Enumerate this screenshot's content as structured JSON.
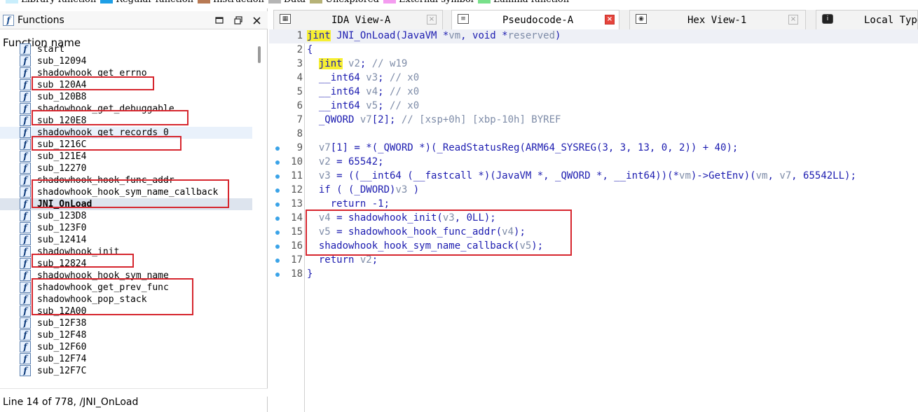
{
  "legend": [
    {
      "label": "Library function",
      "color": "#c9eefc"
    },
    {
      "label": "Regular function",
      "color": "#1e9fe6"
    },
    {
      "label": "Instruction",
      "color": "#b87a54"
    },
    {
      "label": "Data",
      "color": "#b5b5b5"
    },
    {
      "label": "Unexplored",
      "color": "#b6b277"
    },
    {
      "label": "External symbol",
      "color": "#f49cf0"
    },
    {
      "label": "Lumina function",
      "color": "#78e08a"
    }
  ],
  "functions_panel": {
    "title": "Functions",
    "icon_glyph": "f",
    "column_header": "Function name",
    "items": [
      "start",
      "sub_12094",
      "shadowhook_get_errno",
      "sub_120A4",
      "sub_120B8",
      "shadowhook_get_debuggable",
      "sub_120E8",
      "shadowhook_get_records_0",
      "sub_1216C",
      "sub_121E4",
      "sub_12270",
      "shadowhook_hook_func_addr",
      "shadowhook_hook_sym_name_callback",
      "JNI_OnLoad",
      "sub_123D8",
      "sub_123F0",
      "sub_12414",
      "shadowhook_init",
      "sub_12824",
      "shadowhook_hook_sym_name",
      "shadowhook_get_prev_func",
      "shadowhook_pop_stack",
      "sub_12A00",
      "sub_12F38",
      "sub_12F48",
      "sub_12F60",
      "sub_12F74",
      "sub_12F7C"
    ],
    "status": "Line 14 of 778, /JNI_OnLoad"
  },
  "tabs": [
    {
      "label": "IDA View-A",
      "icon": "graph-view-icon",
      "close": "×"
    },
    {
      "label": "Pseudocode-A",
      "icon": "pseudocode-icon",
      "close": "×"
    },
    {
      "label": "Hex View-1",
      "icon": "hex-view-icon",
      "close": "×"
    },
    {
      "label": "Local Types",
      "icon": "local-types-icon",
      "close": ""
    }
  ],
  "code": {
    "line_numbers": [
      "1",
      "2",
      "3",
      "4",
      "5",
      "6",
      "7",
      "8",
      "9",
      "10",
      "11",
      "12",
      "13",
      "14",
      "15",
      "16",
      "17",
      "18"
    ],
    "line1": {
      "kw": "jint",
      "rest": " JNI_OnLoad(JavaVM *vm, void *reserved)"
    },
    "line2": "{",
    "line3": {
      "kw": "jint",
      "rest": " v2; ",
      "cmt": "// w19"
    },
    "line4": {
      "code": "  __int64 v3; ",
      "cmt": "// x0"
    },
    "line5": {
      "code": "  __int64 v4; ",
      "cmt": "// x0"
    },
    "line6": {
      "code": "  __int64 v5; ",
      "cmt": "// x0"
    },
    "line7": {
      "code": "  _QWORD v7[2]; ",
      "cmt": "// [xsp+0h] [xbp-10h] BYREF"
    },
    "line8": "",
    "line9": "  v7[1] = *(_QWORD *)(_ReadStatusReg(ARM64_SYSREG(3, 3, 13, 0, 2)) + 40);",
    "line10": "  v2 = 65542;",
    "line11": "  v3 = ((__int64 (__fastcall *)(JavaVM *, _QWORD *, __int64))(*vm)->GetEnv)(vm, v7, 65542LL);",
    "line12": "  if ( (_DWORD)v3 )",
    "line13": "    return -1;",
    "line14": "  v4 = shadowhook_init(v3, 0LL);",
    "line15": "  v5 = shadowhook_hook_func_addr(v4);",
    "line16": "  shadowhook_hook_sym_name_callback(v5);",
    "line17": "  return v2;",
    "line18": "}"
  },
  "colors": {
    "highlight_box": "#d6262e",
    "keyword": "#1c1cb0",
    "comment": "#7e8ca8",
    "yellow_highlight": "#f6ef32",
    "breakpoint_dot": "#3aa3e8"
  }
}
